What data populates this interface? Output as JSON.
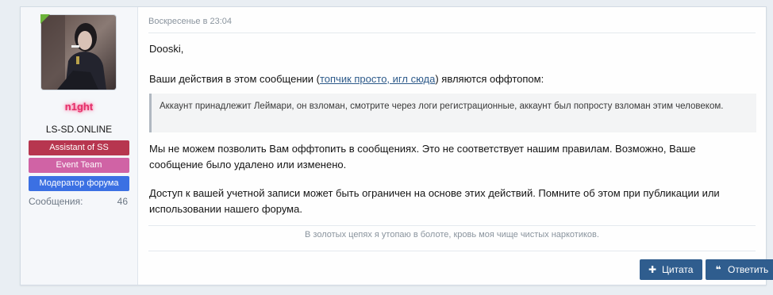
{
  "user": {
    "username": "n1ght",
    "title": "LS-SD.ONLINE",
    "banners": [
      "Assistant of SS",
      "Event Team",
      "Модератор форума"
    ],
    "messages_label": "Сообщения:",
    "messages_count": "46",
    "online": true
  },
  "post": {
    "date": "Воскресенье в 23:04",
    "greeting": "Dooski,",
    "actions_prefix": "Ваши действия в этом сообщении (",
    "actions_link": "топчик просто, игл сюда",
    "actions_suffix": ") являются оффтопом:",
    "quote": "Аккаунт принадлежит Леймари, он взломан, смотрите через логи регистрационные, аккаунт был попросту взломан этим человеком.",
    "rules_text": "Мы не можем позволить Вам оффтопить в сообщениях. Это не соответствует нашим правилам. Возможно, Ваше сообщение было удалено или изменено.",
    "access_text": "Доступ к вашей учетной записи может быть ограничен на основе этих действий. Помните об этом при публикации или использовании нашего форума.",
    "signature": "В золотых цепях я утопаю в болоте, кровь моя чище чистых наркотиков."
  },
  "buttons": {
    "quote_label": "Цитата",
    "reply_label": "Ответить",
    "quote_icon": "plus-icon",
    "reply_icon": "quote-marks-icon"
  },
  "colors": {
    "username": "#e3306a",
    "banner_1": "#b7364f",
    "banner_2": "#d063a5",
    "banner_3": "#3b70e3",
    "button": "#2f5d8e",
    "online_indicator": "#6bb33a"
  }
}
